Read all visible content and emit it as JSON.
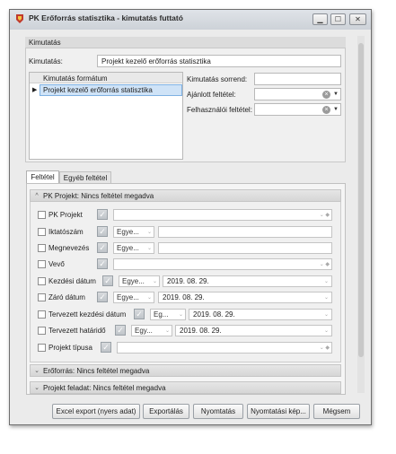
{
  "window": {
    "title": "PK Erőforrás statisztika - kimutatás futtató",
    "minimize_icon": "minimize-icon",
    "maximize_icon": "maximize-icon",
    "close_icon": "close-icon"
  },
  "kimutatas": {
    "group_title": "Kimutatás",
    "label": "Kimutatás:",
    "value": "Projekt kezelő erőforrás statisztika",
    "grid_header": "Kimutatás formátum",
    "grid_rows": [
      "Projekt kezelő erőforrás statisztika"
    ],
    "sorrend_label": "Kimutatás sorrend:",
    "sorrend_value": "",
    "ajanlott_label": "Ajánlott feltétel:",
    "ajanlott_value": "",
    "felhasznaloi_label": "Felhasználói feltétel:",
    "felhasznaloi_value": ""
  },
  "tabs": [
    "Feltétel",
    "Egyéb feltétel"
  ],
  "pk_section": {
    "title": "PK Projekt: Nincs feltétel megadva",
    "rows": [
      {
        "label": "PK Projekt",
        "type": "lookup"
      },
      {
        "label": "Iktatószám",
        "type": "text",
        "operator": "Egye..."
      },
      {
        "label": "Megnevezés",
        "type": "text",
        "operator": "Egye..."
      },
      {
        "label": "Vevő",
        "type": "lookup"
      },
      {
        "label": "Kezdési dátum",
        "type": "date",
        "operator": "Egye...",
        "value": "2019. 08. 29."
      },
      {
        "label": "Záró dátum",
        "type": "date",
        "operator": "Egye...",
        "value": "2019. 08. 29."
      },
      {
        "label": "Tervezett kezdési dátum",
        "type": "date",
        "operator": "Eg...",
        "value": "2019. 08. 29."
      },
      {
        "label": "Tervezett határidő",
        "type": "date",
        "operator": "Egy...",
        "value": "2019. 08. 29."
      },
      {
        "label": "Projekt típusa",
        "type": "lookup"
      }
    ]
  },
  "collapsed_sections": [
    "Erőforrás: Nincs feltétel megadva",
    "Projekt feladat: Nincs feltétel megadva"
  ],
  "buttons": {
    "excel": "Excel export (nyers adat)",
    "export": "Exportálás",
    "print": "Nyomtatás",
    "print_preview": "Nyomtatási kép...",
    "cancel": "Mégsem"
  },
  "colors": {
    "check_gray": "#bfc4c9",
    "title_red": "#c0392b",
    "selection_blue": "#cfe3f7"
  }
}
